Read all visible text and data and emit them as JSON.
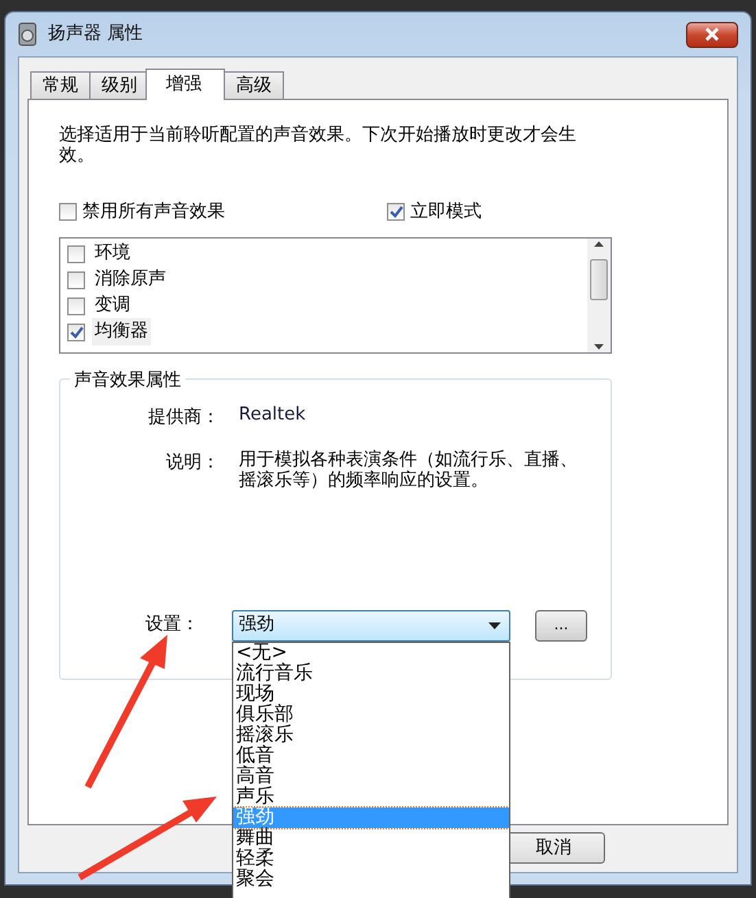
{
  "window": {
    "title": "扬声器 属性"
  },
  "tabs": [
    {
      "label": "常规",
      "selected": false
    },
    {
      "label": "级别",
      "selected": false
    },
    {
      "label": "增强",
      "selected": true
    },
    {
      "label": "高级",
      "selected": false
    }
  ],
  "intro": "选择适用于当前聆听配置的声音效果。下次开始播放时更改才会生效。",
  "options": [
    {
      "label": "禁用所有声音效果",
      "checked": false
    },
    {
      "label": "立即模式",
      "checked": true
    }
  ],
  "effects": [
    {
      "label": "环境",
      "checked": false,
      "selected": false
    },
    {
      "label": "消除原声",
      "checked": false,
      "selected": false
    },
    {
      "label": "变调",
      "checked": false,
      "selected": false
    },
    {
      "label": "均衡器",
      "checked": true,
      "selected": true
    }
  ],
  "properties": {
    "title": "声音效果属性",
    "provider_label": "提供商：",
    "provider": "Realtek",
    "description_label": "说明：",
    "description": "用于模拟各种表演条件（如流行乐、直播、摇滚乐等）的频率响应的设置。",
    "setting_label": "设置：",
    "setting_value": "强劲",
    "more_button": "...",
    "dropdown_items": [
      {
        "label": "<无>",
        "selected": false
      },
      {
        "label": "流行音乐",
        "selected": false
      },
      {
        "label": "现场",
        "selected": false
      },
      {
        "label": "俱乐部",
        "selected": false
      },
      {
        "label": "摇滚乐",
        "selected": false
      },
      {
        "label": "低音",
        "selected": false
      },
      {
        "label": "高音",
        "selected": false
      },
      {
        "label": "声乐",
        "selected": false
      },
      {
        "label": "强劲",
        "selected": true
      },
      {
        "label": "舞曲",
        "selected": false
      },
      {
        "label": "轻柔",
        "selected": false
      },
      {
        "label": "聚会",
        "selected": false
      }
    ]
  },
  "buttons": [
    "取消"
  ]
}
